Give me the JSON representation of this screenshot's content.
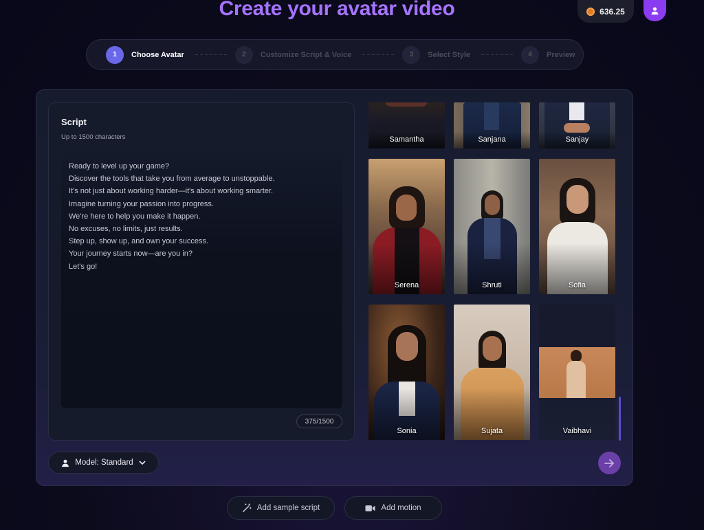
{
  "header": {
    "title": "Create your avatar video",
    "credits": "636.25"
  },
  "stepper": {
    "steps": [
      {
        "num": "1",
        "label": "Choose Avatar"
      },
      {
        "num": "2",
        "label": "Customize Script & Voice"
      },
      {
        "num": "3",
        "label": "Select Style"
      },
      {
        "num": "4",
        "label": "Preview"
      }
    ]
  },
  "script": {
    "title": "Script",
    "subtitle": "Up to 1500 characters",
    "lines": [
      "Ready to level up your game?",
      "Discover the tools that take you from average to unstoppable.",
      "It's not just about working harder—it's about working smarter.",
      "Imagine turning your passion into progress.",
      "We're here to help you make it happen.",
      "No excuses, no limits, just results.",
      "Step up, show up, and own your success.",
      "Your journey starts now—are you in?",
      "Let's go!"
    ],
    "char_count": "375/1500"
  },
  "avatars": [
    {
      "name": "Samantha"
    },
    {
      "name": "Sanjana"
    },
    {
      "name": "Sanjay"
    },
    {
      "name": "Serena"
    },
    {
      "name": "Shruti"
    },
    {
      "name": "Sofia"
    },
    {
      "name": "Sonia"
    },
    {
      "name": "Sujata"
    },
    {
      "name": "Vaibhavi"
    }
  ],
  "footer": {
    "model_label": "Model: Standard",
    "add_sample_script": "Add sample script",
    "add_motion": "Add motion"
  },
  "colors": {
    "accent": "#a673ff",
    "active_step": "#6a68e8",
    "profile": "#8a3df0",
    "next_button": "#6b3fa8"
  }
}
